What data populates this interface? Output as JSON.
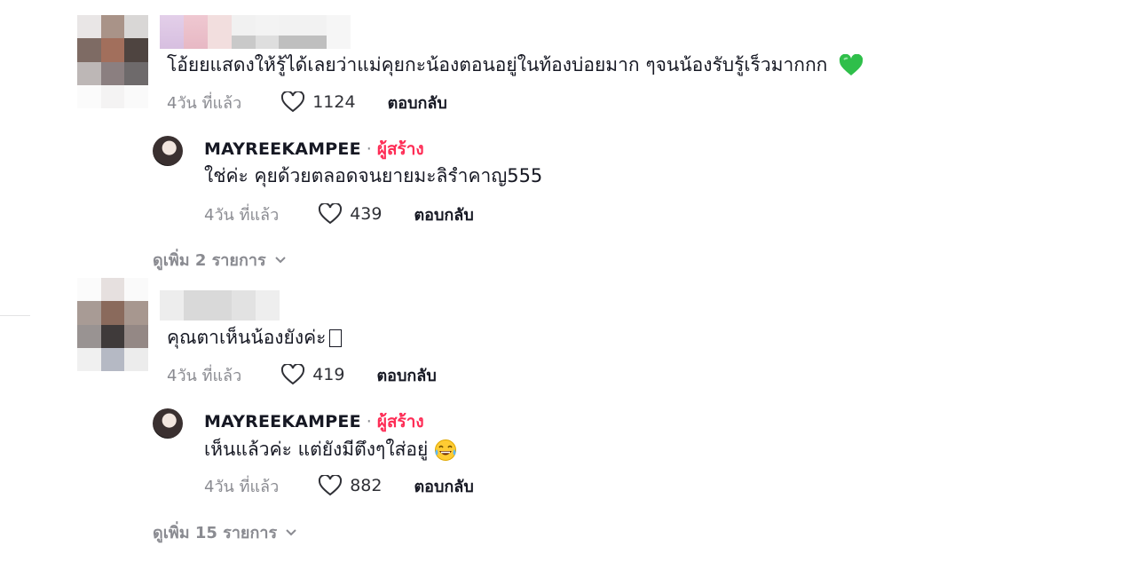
{
  "comments": [
    {
      "text": "โอ้ยยแสดงให้รู้ได้เลยว่าแม่คุยกะน้องตอนอยู่ในท้องบ่อยมาก ๆจนน้องรับรู้เร็วมากกก",
      "emoji": "green-heart-icon",
      "time": "4วัน ที่แล้ว",
      "likes": "1124",
      "reply_label": "ตอบกลับ",
      "reply": {
        "author": "MAYREEKAMPEE",
        "separator": "·",
        "badge": "ผู้สร้าง",
        "text": "ใช่ค่ะ คุยด้วยตลอดจนยายมะลิรำคาญ555",
        "time": "4วัน ที่แล้ว",
        "likes": "439",
        "reply_label": "ตอบกลับ"
      },
      "more_label": "ดูเพิ่ม 2 รายการ"
    },
    {
      "text": "คุณตาเห็นน้องยังค่ะ",
      "emoji": "unsupported-glyph",
      "time": "4วัน ที่แล้ว",
      "likes": "419",
      "reply_label": "ตอบกลับ",
      "reply": {
        "author": "MAYREEKAMPEE",
        "separator": "·",
        "badge": "ผู้สร้าง",
        "text": "เห็นแล้วค่ะ แต่ยังมีตึงๆใส่อยู่",
        "emoji": "laughing-tears-icon",
        "time": "4วัน ที่แล้ว",
        "likes": "882",
        "reply_label": "ตอบกลับ"
      },
      "more_label": "ดูเพิ่ม 15 รายการ"
    }
  ],
  "colors": {
    "creator_badge": "#fe2c55",
    "muted_text": "#8a8b91",
    "primary_text": "#161823",
    "green_heart": "#2fbf4a"
  }
}
